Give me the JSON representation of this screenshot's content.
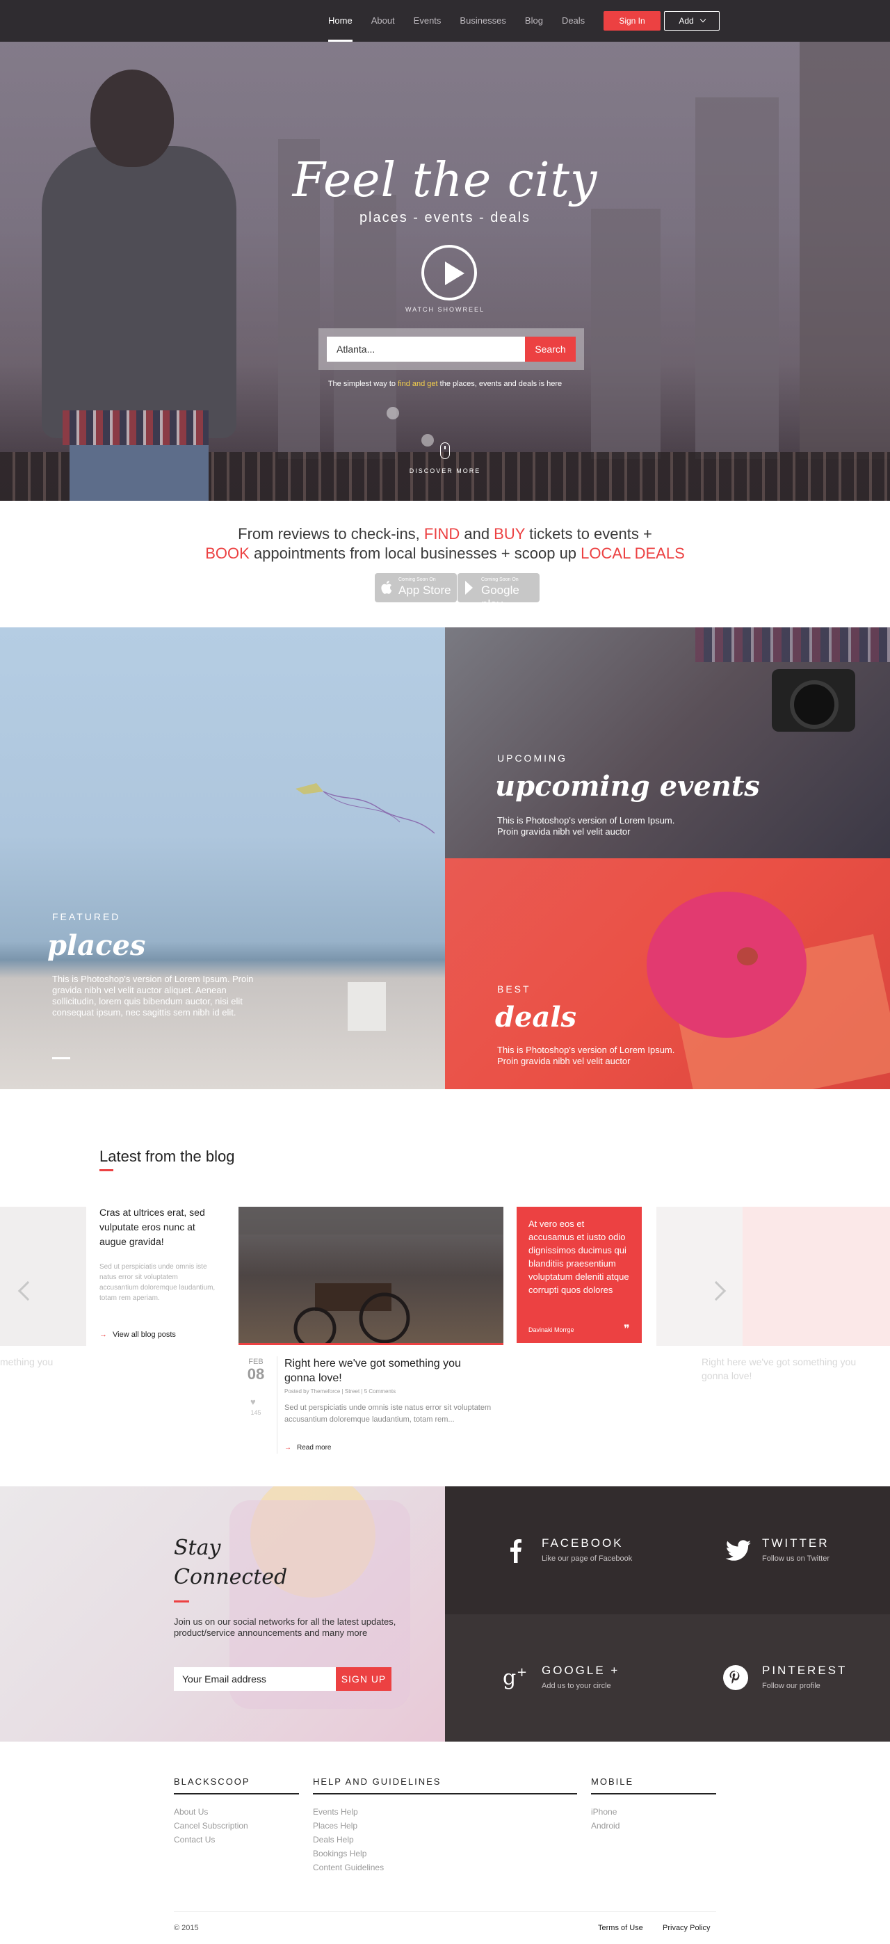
{
  "nav": {
    "links": [
      "Home",
      "About",
      "Events",
      "Businesses",
      "Blog",
      "Deals"
    ],
    "signin_label": "Sign In",
    "add_label": "Add"
  },
  "hero": {
    "title": "Feel the city",
    "subtitle": "places  -  events  -  deals",
    "play_label": "WATCH SHOWREEL",
    "search_placeholder": "Atlanta...",
    "search_button": "Search",
    "tagline_pre": "The simplest way to ",
    "tagline_highlight": "find and get",
    "tagline_post": " the places, events and deals is here",
    "discover_label": "DISCOVER MORE"
  },
  "promo": {
    "line1_a": "From reviews to check-ins, ",
    "line1_find": "FIND",
    "line1_b": " and ",
    "line1_buy": "BUY",
    "line1_c": " tickets to events +",
    "line2_book": "BOOK",
    "line2_a": " appointments from local businesses + scoop up ",
    "line2_deals": "LOCAL DEALS",
    "appstore_small": "Coming Soon On",
    "appstore_label": "App Store",
    "googleplay_small": "Coming Soon On",
    "googleplay_label": "Google play"
  },
  "features": {
    "places": {
      "kicker": "FEATURED",
      "title": "places",
      "desc": "This is Photoshop's version  of Lorem Ipsum. Proin gravida nibh vel velit auctor aliquet. Aenean sollicitudin, lorem quis bibendum auctor, nisi elit consequat ipsum, nec sagittis sem nibh id elit."
    },
    "upcoming": {
      "kicker": "UPCOMING",
      "title": "upcoming events",
      "desc": "This is Photoshop's version  of Lorem Ipsum. Proin gravida nibh vel velit auctor"
    },
    "deals": {
      "kicker": "BEST",
      "title": "deals",
      "desc": "This is Photoshop's version  of Lorem Ipsum. Proin gravida nibh vel velit auctor"
    }
  },
  "blog": {
    "section_title": "Latest from the blog",
    "ghost_left_text": "mething you",
    "ghost_right_title": "Right here we've got something you gonna love!",
    "intro_title": "Cras at ultrices erat, sed vulputate eros nunc at augue gravida!",
    "intro_text": "Sed ut perspiciatis unde omnis iste natus error sit voluptatem accusantium doloremque laudantium, totam rem aperiam.",
    "view_all": "View all blog posts",
    "post": {
      "month": "FEB",
      "day": "08",
      "likes": "145",
      "title": "Right here we've got something you gonna love!",
      "meta": "Posted by Themeforce | Street | 5 Comments",
      "text": "Sed ut perspiciatis unde omnis iste natus error sit voluptatem accusantium doloremque laudantium, totam rem...",
      "read_more": "Read more"
    },
    "quote": {
      "text": "At vero eos et accusamus et iusto odio dignissimos ducimus qui blanditiis praesentium voluptatum deleniti atque corrupti quos dolores",
      "author": "Davinaki Morrge"
    }
  },
  "stay": {
    "title_line1": "Stay",
    "title_line2": "Connected",
    "text": "Join us on our social networks for all the latest updates, product/service announcements and many more",
    "email_placeholder": "Your Email address",
    "signup_label": "SIGN UP"
  },
  "social": {
    "facebook": {
      "name": "FACEBOOK",
      "sub": "Like our page of Facebook"
    },
    "twitter": {
      "name": "TWITTER",
      "sub": "Follow us on Twitter"
    },
    "google": {
      "name": "GOOGLE +",
      "sub": "Add us to your circle"
    },
    "pinterest": {
      "name": "PINTEREST",
      "sub": "Follow our profile"
    }
  },
  "footer": {
    "col1_title": "BLACKSCOOP",
    "col1_links": [
      "About Us",
      "Cancel Subscription",
      "Contact Us"
    ],
    "col2_title": "HELP AND GUIDELINES",
    "col2_links": [
      "Events Help",
      "Places Help",
      "Deals Help",
      "Bookings Help",
      "Content Guidelines"
    ],
    "col3_title": "MOBILE",
    "col3_links": [
      "iPhone",
      "Android"
    ],
    "copyright": "© 2015",
    "terms": "Terms of Use",
    "privacy": "Privacy Policy"
  },
  "colors": {
    "accent": "#ec4142",
    "nav_bg": "#2f2c30",
    "social_bg": "#322c2d",
    "highlight": "#f5d04c"
  }
}
